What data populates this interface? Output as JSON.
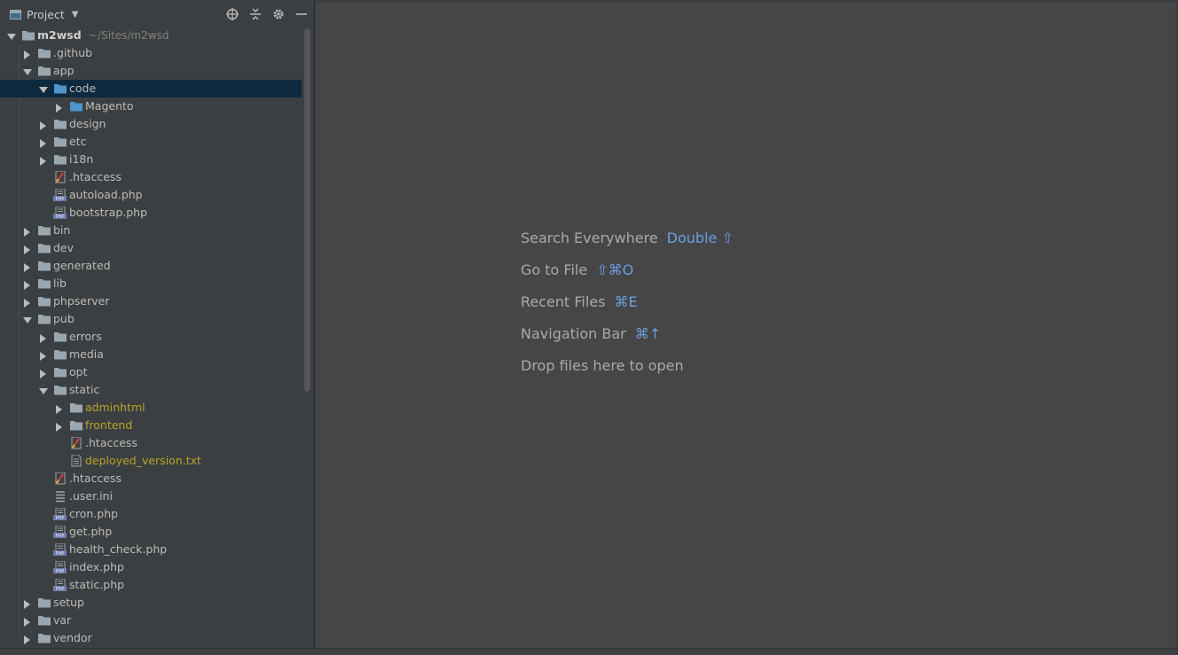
{
  "panel": {
    "title": "Project",
    "icons": [
      "locate-icon",
      "collapse-all-icon",
      "gear-icon",
      "minimize-icon"
    ]
  },
  "tree": [
    {
      "label": "m2wsd",
      "path": "~/Sites/m2wsd",
      "type": "folder",
      "depth": 0,
      "expanded": true,
      "bold": true
    },
    {
      "label": ".github",
      "type": "folder",
      "depth": 1,
      "expanded": false
    },
    {
      "label": "app",
      "type": "folder",
      "depth": 1,
      "expanded": true
    },
    {
      "label": "code",
      "type": "folder-blue",
      "depth": 2,
      "expanded": true,
      "selected": true
    },
    {
      "label": "Magento",
      "type": "folder-blue",
      "depth": 3,
      "expanded": false
    },
    {
      "label": "design",
      "type": "folder",
      "depth": 2,
      "expanded": false
    },
    {
      "label": "etc",
      "type": "folder",
      "depth": 2,
      "expanded": false
    },
    {
      "label": "i18n",
      "type": "folder",
      "depth": 2,
      "expanded": false
    },
    {
      "label": ".htaccess",
      "type": "htaccess",
      "depth": 2
    },
    {
      "label": "autoload.php",
      "type": "php",
      "depth": 2
    },
    {
      "label": "bootstrap.php",
      "type": "php",
      "depth": 2
    },
    {
      "label": "bin",
      "type": "folder",
      "depth": 1,
      "expanded": false
    },
    {
      "label": "dev",
      "type": "folder",
      "depth": 1,
      "expanded": false
    },
    {
      "label": "generated",
      "type": "folder",
      "depth": 1,
      "expanded": false
    },
    {
      "label": "lib",
      "type": "folder",
      "depth": 1,
      "expanded": false
    },
    {
      "label": "phpserver",
      "type": "folder",
      "depth": 1,
      "expanded": false
    },
    {
      "label": "pub",
      "type": "folder",
      "depth": 1,
      "expanded": true
    },
    {
      "label": "errors",
      "type": "folder",
      "depth": 2,
      "expanded": false
    },
    {
      "label": "media",
      "type": "folder",
      "depth": 2,
      "expanded": false
    },
    {
      "label": "opt",
      "type": "folder",
      "depth": 2,
      "expanded": false
    },
    {
      "label": "static",
      "type": "folder",
      "depth": 2,
      "expanded": true
    },
    {
      "label": "adminhtml",
      "type": "folder",
      "depth": 3,
      "expanded": false,
      "yellow": true
    },
    {
      "label": "frontend",
      "type": "folder",
      "depth": 3,
      "expanded": false,
      "yellow": true
    },
    {
      "label": ".htaccess",
      "type": "htaccess",
      "depth": 3
    },
    {
      "label": "deployed_version.txt",
      "type": "txt",
      "depth": 3,
      "yellow": true
    },
    {
      "label": ".htaccess",
      "type": "htaccess",
      "depth": 2
    },
    {
      "label": ".user.ini",
      "type": "ini",
      "depth": 2
    },
    {
      "label": "cron.php",
      "type": "php",
      "depth": 2
    },
    {
      "label": "get.php",
      "type": "php",
      "depth": 2
    },
    {
      "label": "health_check.php",
      "type": "php",
      "depth": 2
    },
    {
      "label": "index.php",
      "type": "php",
      "depth": 2
    },
    {
      "label": "static.php",
      "type": "php",
      "depth": 2
    },
    {
      "label": "setup",
      "type": "folder",
      "depth": 1,
      "expanded": false
    },
    {
      "label": "var",
      "type": "folder",
      "depth": 1,
      "expanded": false
    },
    {
      "label": "vendor",
      "type": "folder",
      "depth": 1,
      "expanded": false
    }
  ],
  "hints": [
    {
      "text": "Search Everywhere",
      "key": "Double ⇧"
    },
    {
      "text": "Go to File",
      "key": "⇧⌘O"
    },
    {
      "text": "Recent Files",
      "key": "⌘E"
    },
    {
      "text": "Navigation Bar",
      "key": "⌘↑"
    },
    {
      "text": "Drop files here to open",
      "key": ""
    }
  ],
  "colors": {
    "background": "#3c3f41",
    "editor": "#464646",
    "selection": "#0d293e",
    "key": "#6a9fe0",
    "excluded": "#b4a32b",
    "folder": "#9aa7b0",
    "folderBlue": "#4d94c9"
  }
}
